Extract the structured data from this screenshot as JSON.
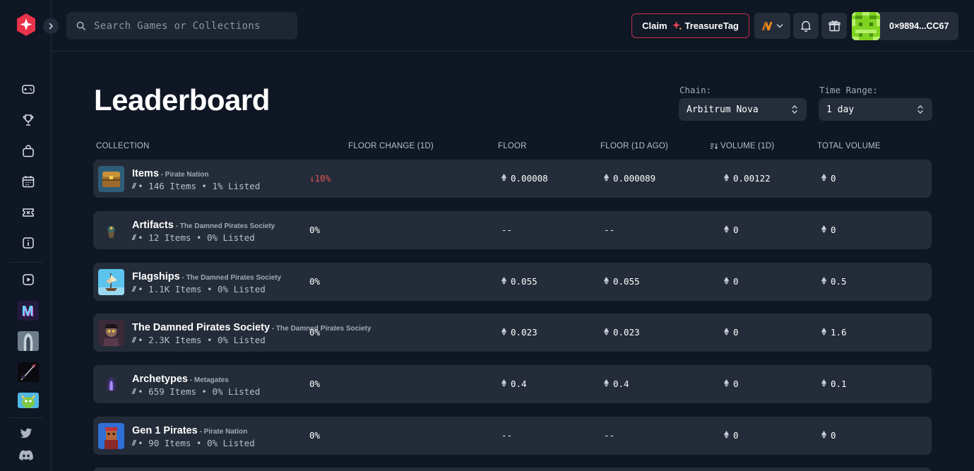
{
  "search": {
    "placeholder": "Search Games or Collections"
  },
  "header": {
    "claim_label_prefix": "Claim",
    "claim_label_suffix": "TreasureTag",
    "wallet_address": "0×9894...CC67"
  },
  "page": {
    "title": "Leaderboard"
  },
  "filters": {
    "chain_label": "Chain:",
    "chain_value": "Arbitrum Nova",
    "time_label": "Time Range:",
    "time_value": "1 day"
  },
  "columns": {
    "collection": "COLLECTION",
    "floor_change": "FLOOR CHANGE (1D)",
    "floor": "FLOOR",
    "floor_ago": "FLOOR (1D AGO)",
    "volume": "VOLUME (1D)",
    "total_volume": "TOTAL VOLUME"
  },
  "rows": [
    {
      "name": "Items",
      "sub": " - Pirate Nation",
      "meta": "• 146 Items • 1% Listed",
      "change": "↓10%",
      "floor": "0.00008",
      "floor_ago": "0.000089",
      "volume": "0.00122",
      "total": "0"
    },
    {
      "name": "Artifacts",
      "sub": " - The Damned Pirates Society",
      "meta": "• 12 Items • 0% Listed",
      "change": "0%",
      "floor": "--",
      "floor_ago": "--",
      "volume": "0",
      "total": "0"
    },
    {
      "name": "Flagships",
      "sub": " - The Damned Pirates Society",
      "meta": "• 1.1K Items • 0% Listed",
      "change": "0%",
      "floor": "0.055",
      "floor_ago": "0.055",
      "volume": "0",
      "total": "0.5"
    },
    {
      "name": "The Damned Pirates Society",
      "sub": " - The Damned Pirates Society",
      "meta": "• 2.3K Items • 0% Listed",
      "change": "0%",
      "floor": "0.023",
      "floor_ago": "0.023",
      "volume": "0",
      "total": "1.6"
    },
    {
      "name": "Archetypes",
      "sub": " - Metagates",
      "meta": "• 659 Items • 0% Listed",
      "change": "0%",
      "floor": "0.4",
      "floor_ago": "0.4",
      "volume": "0",
      "total": "0.1"
    },
    {
      "name": "Gen 1 Pirates",
      "sub": " - Pirate Nation",
      "meta": "• 90 Items • 0% Listed",
      "change": "0%",
      "floor": "--",
      "floor_ago": "--",
      "volume": "0",
      "total": "0"
    }
  ],
  "colors": {
    "accent": "#e8334a",
    "down": "#e35454",
    "background": "#0f1624",
    "row": "#252c39"
  }
}
